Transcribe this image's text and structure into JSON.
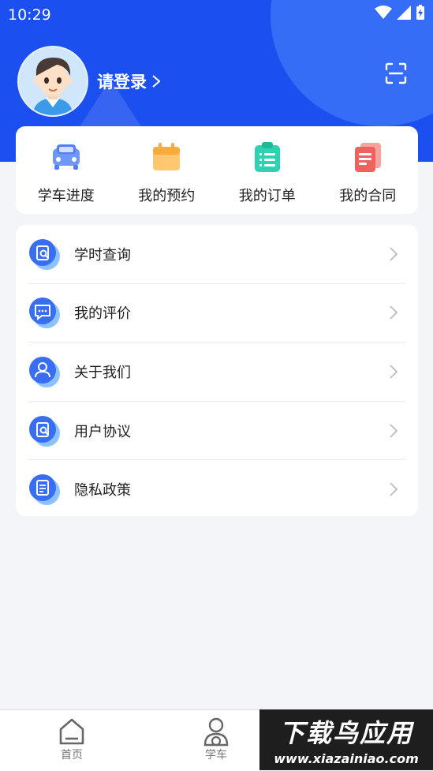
{
  "status_bar": {
    "time": "10:29"
  },
  "header": {
    "login_label": "请登录",
    "scan_icon": "scan-icon"
  },
  "quick_actions": [
    {
      "label": "学车进度",
      "icon": "car-icon",
      "color": "#4f7ef5"
    },
    {
      "label": "我的预约",
      "icon": "calendar-icon",
      "color": "#ffb74a"
    },
    {
      "label": "我的订单",
      "icon": "clipboard-icon",
      "color": "#2cd3b1"
    },
    {
      "label": "我的合同",
      "icon": "document-icon",
      "color": "#f0625e"
    }
  ],
  "menu": [
    {
      "label": "学时查询",
      "icon": "search-doc-icon"
    },
    {
      "label": "我的评价",
      "icon": "chat-icon"
    },
    {
      "label": "关于我们",
      "icon": "user-icon"
    },
    {
      "label": "用户协议",
      "icon": "search-doc-icon"
    },
    {
      "label": "隐私政策",
      "icon": "doc-icon"
    }
  ],
  "bottom_nav": [
    {
      "label": "首页",
      "icon": "home-icon"
    },
    {
      "label": "学车",
      "icon": "driver-icon"
    }
  ],
  "watermark": {
    "title": "下载鸟应用",
    "url": "www.xiazainiao.com"
  },
  "colors": {
    "primary": "#1c4ff0",
    "menu_icon": "#3a6ef2"
  }
}
